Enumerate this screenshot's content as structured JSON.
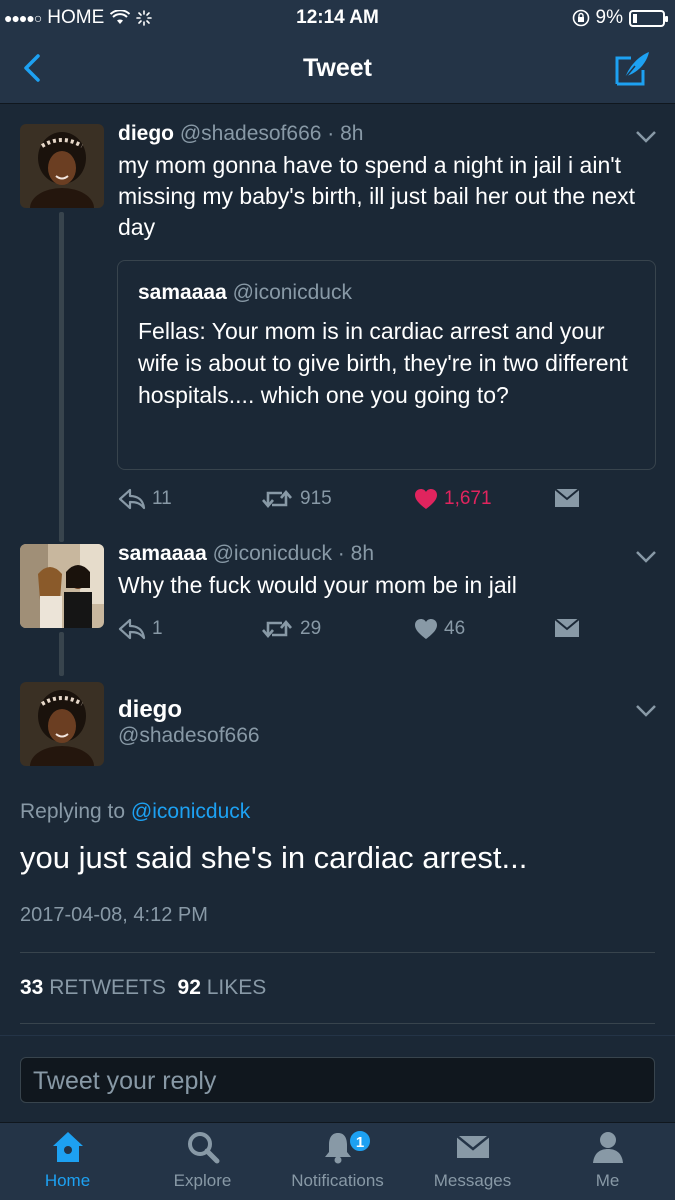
{
  "status_bar": {
    "carrier": "HOME",
    "time": "12:14 AM",
    "battery": "9%"
  },
  "nav": {
    "title": "Tweet"
  },
  "thread": [
    {
      "name": "diego",
      "handle": "@shadesof666",
      "age": "8h",
      "text": "my mom gonna have to spend a night in jail i ain't missing my baby's birth, ill just bail her out the next day",
      "quote": {
        "name": "samaaaa",
        "handle": "@iconicduck",
        "text": "Fellas: Your mom is in cardiac arrest and your wife is about to give birth, they're in two different hospitals.... which one you going to?"
      },
      "replies": "11",
      "retweets": "915",
      "likes": "1,671",
      "liked": true
    },
    {
      "name": "samaaaa",
      "handle": "@iconicduck",
      "age": "8h",
      "text": "Why the fuck would your mom be in jail",
      "replies": "1",
      "retweets": "29",
      "likes": "46",
      "liked": false
    }
  ],
  "focus": {
    "name": "diego",
    "handle": "@shadesof666",
    "replying_prefix": "Replying to",
    "replying_to": "@iconicduck",
    "text": "you just said she's in cardiac arrest...",
    "timestamp": "2017-04-08, 4:12 PM",
    "retweet_count": "33",
    "retweet_label": "RETWEETS",
    "like_count": "92",
    "like_label": "LIKES"
  },
  "reply": {
    "placeholder": "Tweet your reply"
  },
  "tabbar": {
    "items": [
      {
        "label": "Home",
        "icon": "home-icon",
        "active": true
      },
      {
        "label": "Explore",
        "icon": "search-icon"
      },
      {
        "label": "Notifications",
        "icon": "bell-icon",
        "badge": "1"
      },
      {
        "label": "Messages",
        "icon": "envelope-icon"
      },
      {
        "label": "Me",
        "icon": "person-icon"
      }
    ]
  },
  "colors": {
    "background": "#1b2836",
    "bar": "#243447",
    "accent": "#1da1f2",
    "like": "#e0245e",
    "secondary_text": "#8899a6"
  }
}
